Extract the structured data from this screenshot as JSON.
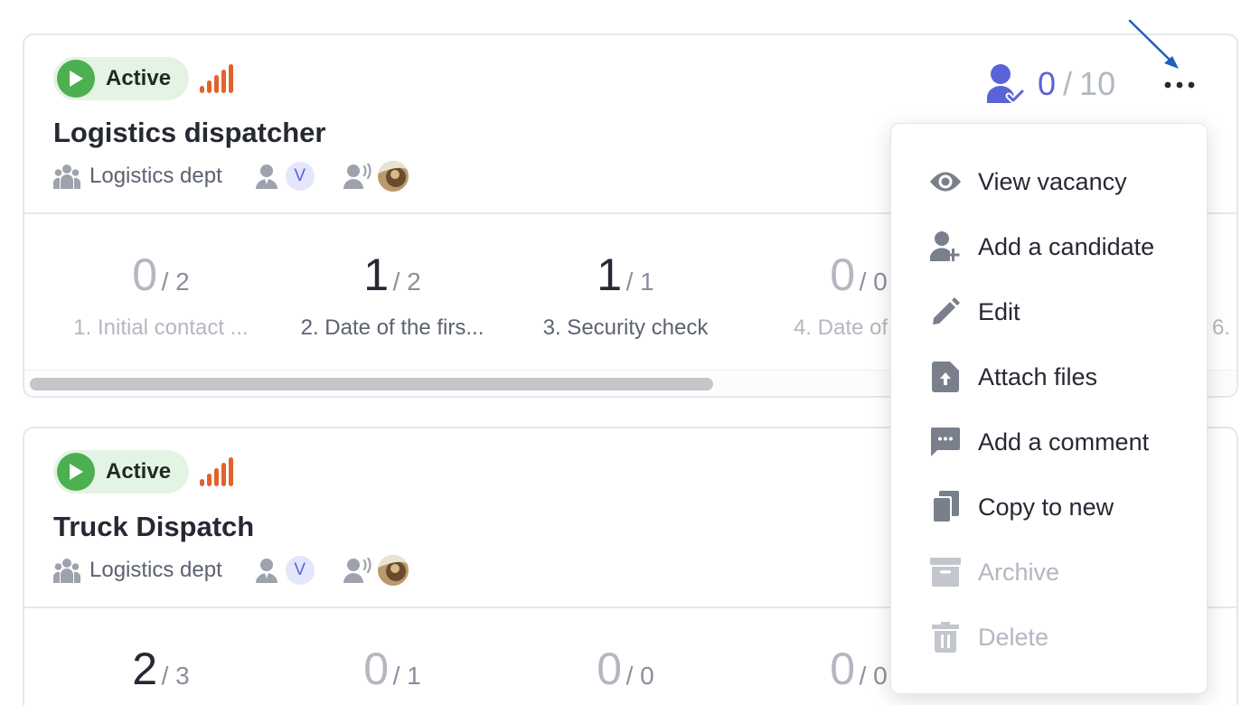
{
  "cards": [
    {
      "status": "Active",
      "title": "Logistics dispatcher",
      "department": "Logistics dept",
      "recruiter_initial": "V",
      "hired": "0",
      "hired_total": "10",
      "stages": [
        {
          "count": "0",
          "total": "/ 2",
          "name": "1. Initial contact ..."
        },
        {
          "count": "1",
          "total": "/ 2",
          "name": "2. Date of the firs..."
        },
        {
          "count": "1",
          "total": "/ 1",
          "name": "3. Security check"
        },
        {
          "count": "0",
          "total": "/ 0",
          "name": "4. Date of the"
        },
        {
          "name": "6."
        }
      ]
    },
    {
      "status": "Active",
      "title": "Truck Dispatch",
      "department": "Logistics dept",
      "recruiter_initial": "V",
      "stages": [
        {
          "count": "2",
          "total": "/ 3"
        },
        {
          "count": "0",
          "total": "/ 1"
        },
        {
          "count": "0",
          "total": "/ 0"
        },
        {
          "count": "0",
          "total": "/ 0"
        }
      ]
    }
  ],
  "menu": {
    "items": [
      {
        "label": "View vacancy",
        "icon": "eye-icon"
      },
      {
        "label": "Add a candidate",
        "icon": "add-person-icon"
      },
      {
        "label": "Edit",
        "icon": "pencil-icon"
      },
      {
        "label": "Attach files",
        "icon": "file-upload-icon"
      },
      {
        "label": "Add a comment",
        "icon": "comment-icon"
      },
      {
        "label": "Copy to new",
        "icon": "copy-icon"
      },
      {
        "label": "Archive",
        "icon": "archive-icon",
        "disabled": true
      },
      {
        "label": "Delete",
        "icon": "trash-icon",
        "disabled": true
      }
    ]
  },
  "colors": {
    "active_green": "#4caf50",
    "active_bg": "#e3f3e4",
    "signal_orange": "#e0632f",
    "accent_blue": "#5b63d8",
    "icon_gray": "#7a7f8c",
    "disabled_gray": "#b3b7c0"
  }
}
